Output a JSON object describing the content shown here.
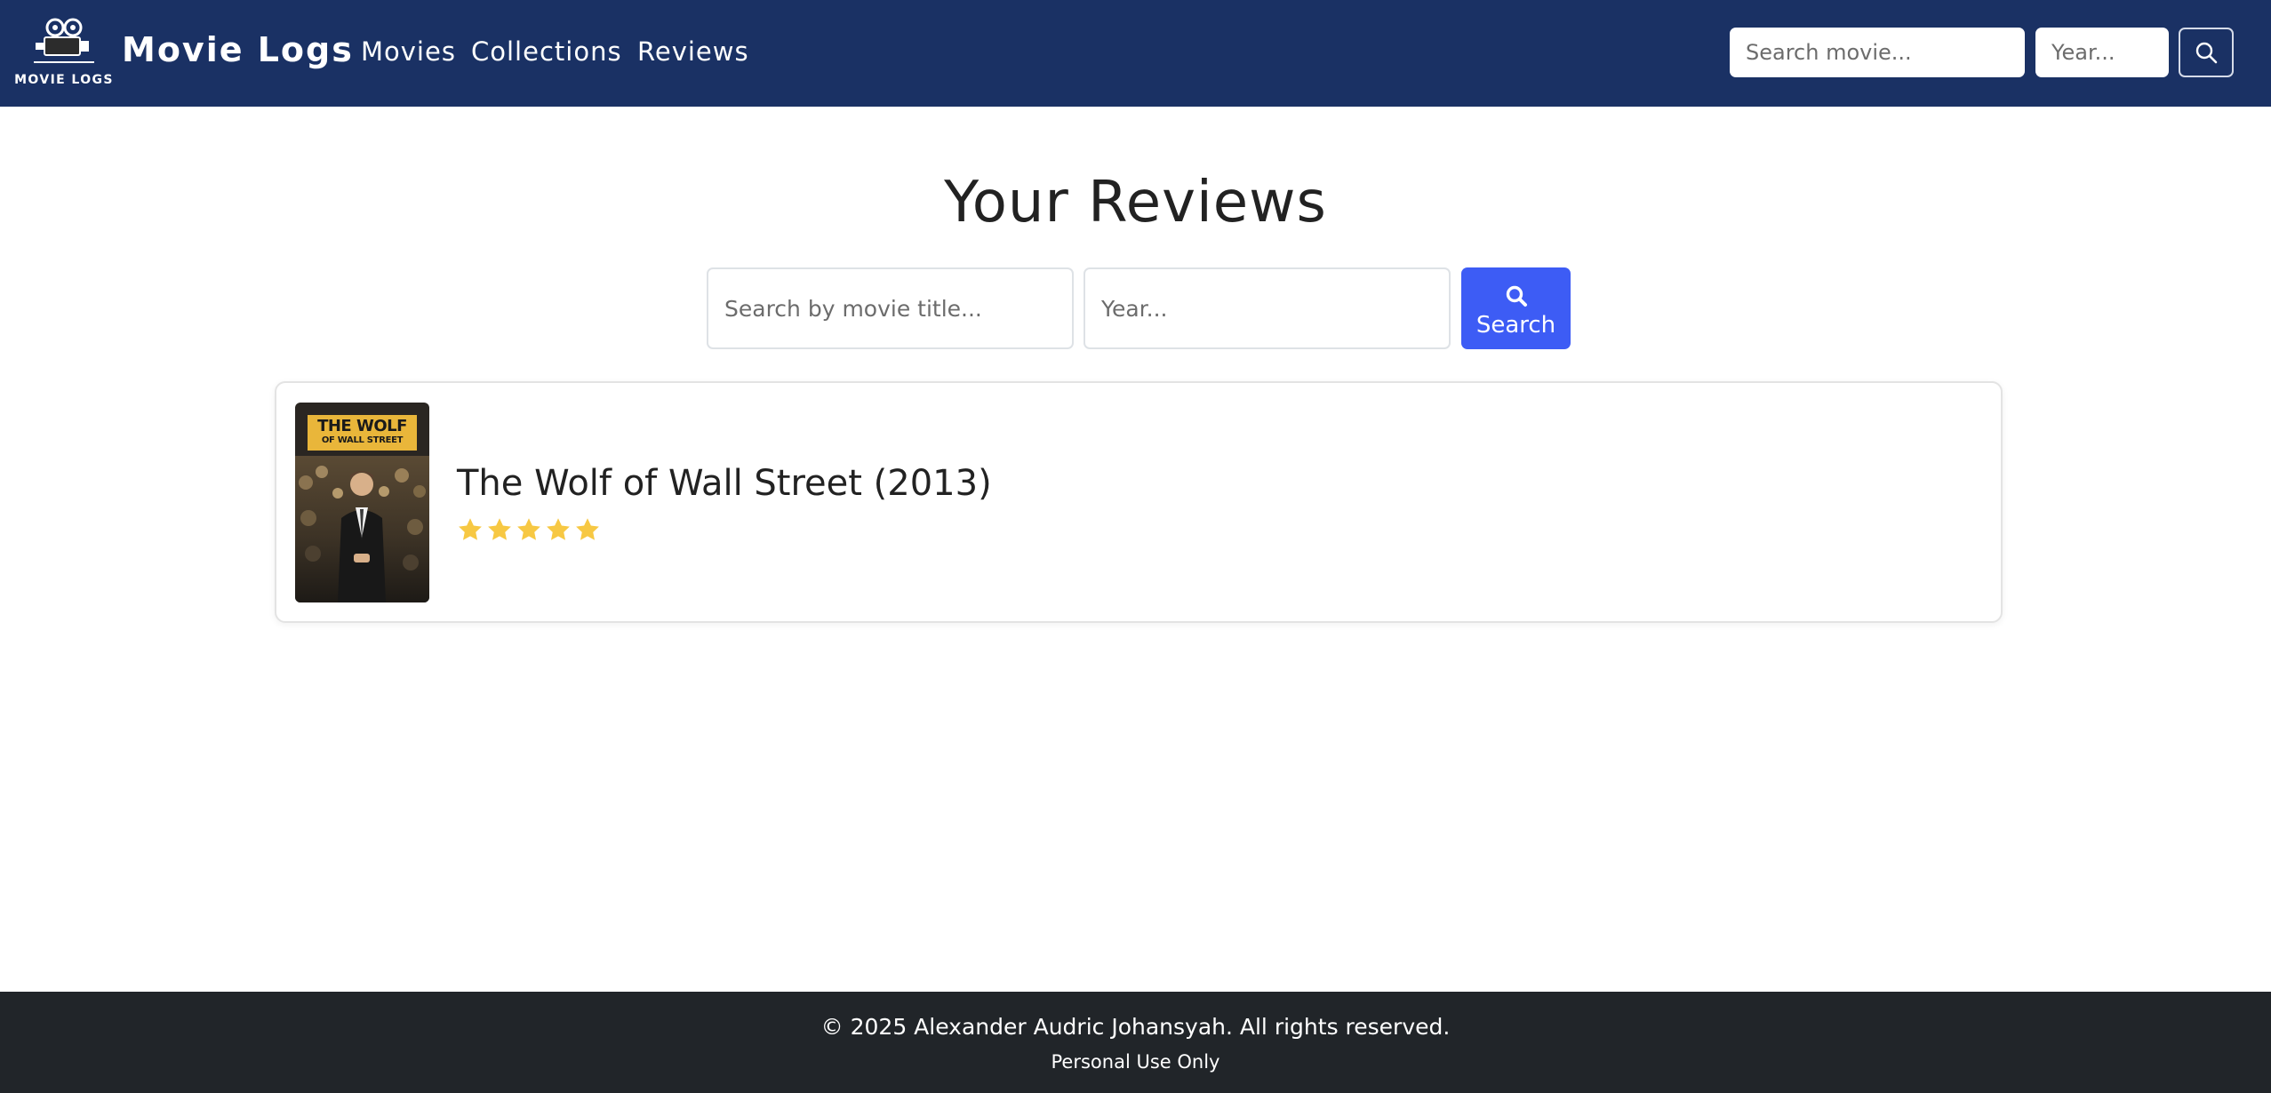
{
  "navbar": {
    "logo_text": "MOVIE LOGS",
    "brand_title": "Movie Logs",
    "links": [
      "Movies",
      "Collections",
      "Reviews"
    ],
    "search_placeholder": "Search movie...",
    "year_placeholder": "Year...",
    "search_button_icon": "search-icon",
    "background_color": "#1a3164"
  },
  "main": {
    "title": "Your Reviews",
    "title_search_placeholder": "Search by movie title...",
    "year_search_placeholder": "Year...",
    "search_button_label": "Search",
    "search_button_icon": "search-icon",
    "search_button_color": "#3d5cf5"
  },
  "reviews": [
    {
      "title": "The Wolf of Wall Street (2013)",
      "rating": 5,
      "rating_max": 5,
      "star_icon": "star-icon",
      "star_color": "#f7c843",
      "poster_text_line1": "THE WOLF",
      "poster_text_line2": "OF WALL STREET"
    }
  ],
  "footer": {
    "copyright": "© 2025 Alexander Audric Johansyah. All rights reserved.",
    "note": "Personal Use Only",
    "background_color": "#212529"
  }
}
